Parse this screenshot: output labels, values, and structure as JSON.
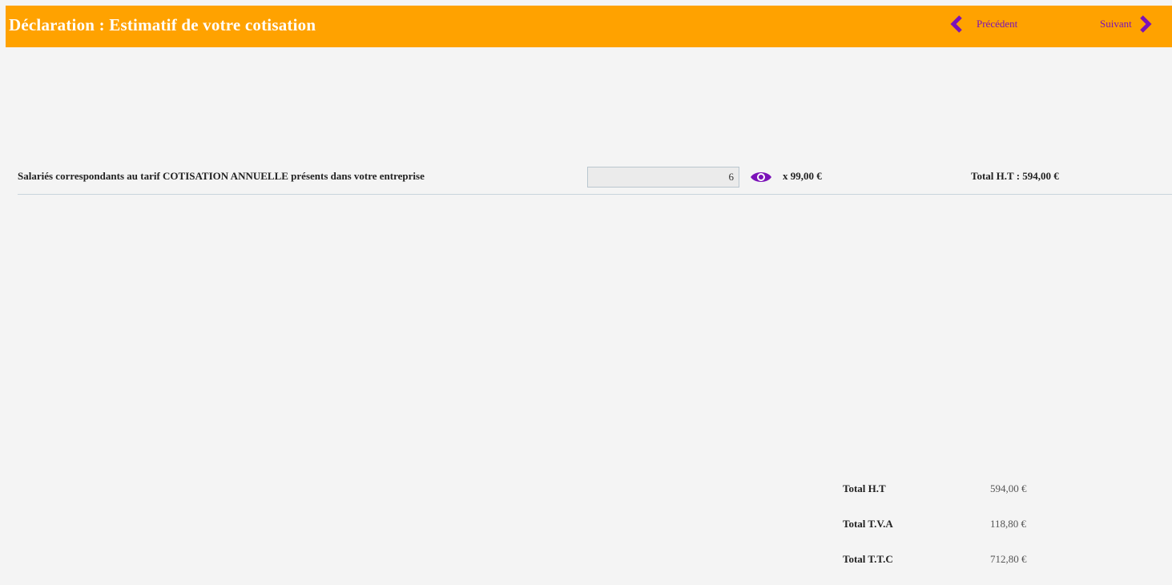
{
  "header": {
    "title": "Déclaration : Estimatif de votre cotisation",
    "prev_label": "Précédent",
    "next_label": "Suivant"
  },
  "line": {
    "label": "Salariés correspondants au tarif COTISATION ANNUELLE présents dans votre entreprise",
    "quantity": "6",
    "unit_price": "x 99,00 €",
    "total": "Total H.T : 594,00 €"
  },
  "summary": [
    {
      "label": "Total H.T",
      "value": "594,00 €"
    },
    {
      "label": "Total T.V.A",
      "value": "118,80 €"
    },
    {
      "label": "Total T.T.C",
      "value": "712,80 €"
    }
  ],
  "colors": {
    "header_bg": "#ffa200",
    "accent": "#7b12b8",
    "background": "#f4f4f4"
  },
  "icons": {
    "prev": "chevron-left-icon",
    "next": "chevron-right-icon",
    "view": "eye-icon"
  }
}
